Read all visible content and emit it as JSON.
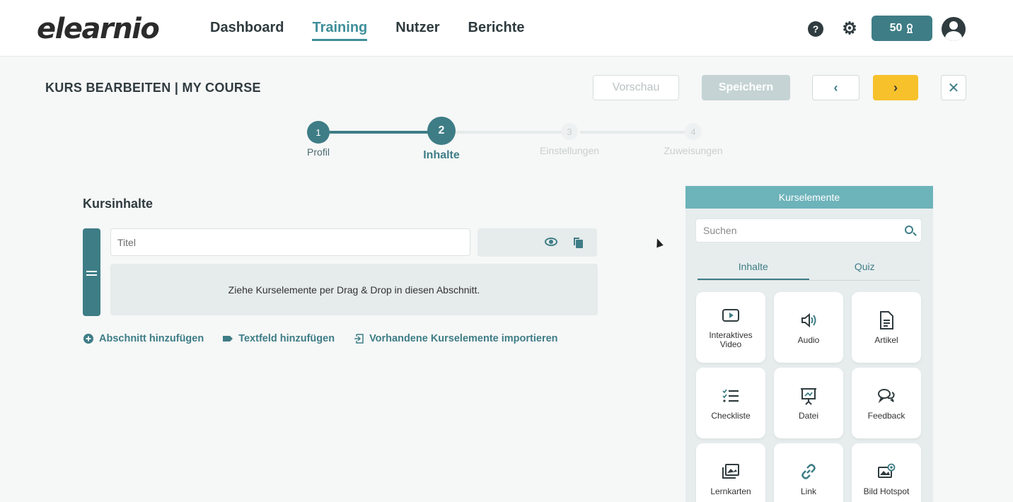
{
  "header": {
    "logo": "elearnio",
    "nav": [
      {
        "label": "Dashboard",
        "active": false
      },
      {
        "label": "Training",
        "active": true
      },
      {
        "label": "Nutzer",
        "active": false
      },
      {
        "label": "Berichte",
        "active": false
      }
    ],
    "help_icon": "question-circle-icon",
    "settings_icon": "gear-icon",
    "points": "50",
    "points_icon": "coin-icon",
    "accent_color": "#3e7d86"
  },
  "toolbar": {
    "page_title": "KURS BEARBEITEN | MY COURSE",
    "preview_label": "Vorschau",
    "save_label": "Speichern",
    "prev_label": "‹",
    "next_label": "›",
    "close_label": "✕",
    "next_color": "#f6c12b"
  },
  "stepper": {
    "steps": [
      {
        "number": "1",
        "label": "Profil",
        "state": "done"
      },
      {
        "number": "2",
        "label": "Inhalte",
        "state": "active"
      },
      {
        "number": "3",
        "label": "Einstellungen",
        "state": "upcoming"
      },
      {
        "number": "4",
        "label": "Zuweisungen",
        "state": "upcoming"
      }
    ]
  },
  "content": {
    "section_title": "Kursinhalte",
    "title_placeholder": "Titel",
    "dropzone_text": "Ziehe Kurselemente per Drag & Drop in diesen Abschnitt.",
    "links": [
      {
        "label": "Abschnitt hinzufügen",
        "icon": "plus-circle-icon"
      },
      {
        "label": "Textfeld hinzufügen",
        "icon": "tag-icon"
      },
      {
        "label": "Vorhandene Kurselemente importieren",
        "icon": "import-icon"
      }
    ]
  },
  "panel": {
    "title": "Kurselemente",
    "search_placeholder": "Suchen",
    "tabs": [
      {
        "label": "Inhalte",
        "active": true
      },
      {
        "label": "Quiz",
        "active": false
      }
    ],
    "tiles": [
      {
        "label": "Interaktives Video",
        "icon": "video-icon"
      },
      {
        "label": "Audio",
        "icon": "audio-icon"
      },
      {
        "label": "Artikel",
        "icon": "article-icon"
      },
      {
        "label": "Checkliste",
        "icon": "checklist-icon"
      },
      {
        "label": "Datei",
        "icon": "file-presentation-icon"
      },
      {
        "label": "Feedback",
        "icon": "feedback-icon"
      },
      {
        "label": "Lernkarten",
        "icon": "flashcards-icon"
      },
      {
        "label": "Link",
        "icon": "link-icon"
      },
      {
        "label": "Bild Hotspot",
        "icon": "image-hotspot-icon"
      }
    ]
  }
}
